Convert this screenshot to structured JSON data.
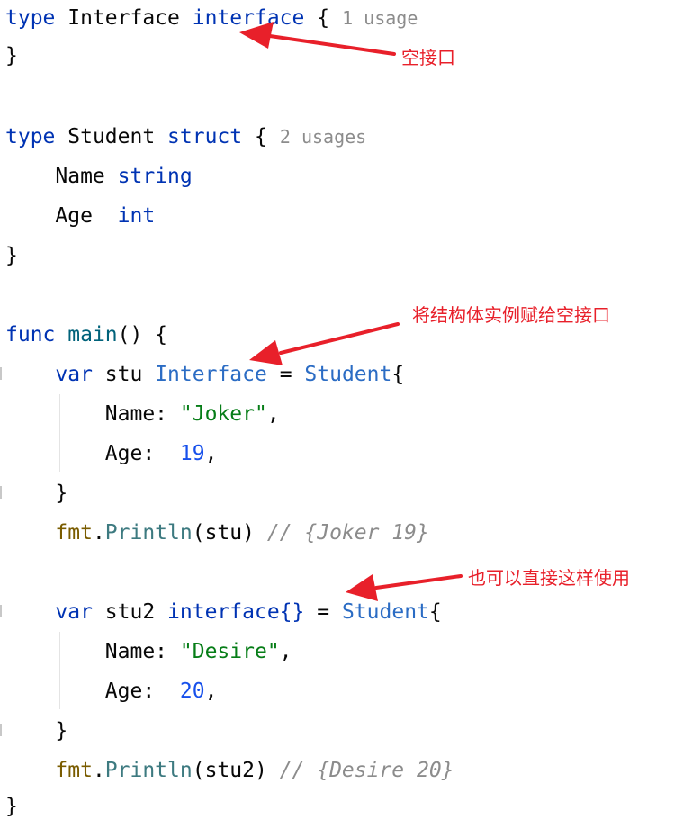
{
  "code": {
    "l1": {
      "kw": "type",
      "name": "Interface",
      "kw2": "interface",
      "brace": "{",
      "hint": "1 usage"
    },
    "l2": {
      "brace": "}"
    },
    "l3": {
      "kw": "type",
      "name": "Student",
      "kw2": "struct",
      "brace": "{",
      "hint": "2 usages"
    },
    "l4": {
      "field": "Name",
      "type": "string"
    },
    "l5": {
      "field": "Age",
      "type": "int"
    },
    "l6": {
      "brace": "}"
    },
    "l7": {
      "kw": "func",
      "name": "main",
      "rest": "() {"
    },
    "l8": {
      "kw": "var",
      "ident": "stu",
      "type": "Interface",
      "eq": "=",
      "ctor": "Student",
      "brace": "{"
    },
    "l9": {
      "field": "Name:",
      "value": "\"Joker\"",
      "comma": ","
    },
    "l10": {
      "field": "Age:",
      "value": "19",
      "comma": ","
    },
    "l11": {
      "brace": "}"
    },
    "l12": {
      "pkg": "fmt",
      "dot": ".",
      "fn": "Println",
      "args": "(stu)",
      "comment": "// {Joker 19}"
    },
    "l13": {
      "kw": "var",
      "ident": "stu2",
      "type": "interface{}",
      "eq": "=",
      "ctor": "Student",
      "brace": "{"
    },
    "l14": {
      "field": "Name:",
      "value": "\"Desire\"",
      "comma": ","
    },
    "l15": {
      "field": "Age:",
      "value": "20",
      "comma": ","
    },
    "l16": {
      "brace": "}"
    },
    "l17": {
      "pkg": "fmt",
      "dot": ".",
      "fn": "Println",
      "args": "(stu2)",
      "comment": "// {Desire 20}"
    },
    "l18": {
      "brace": "}"
    }
  },
  "annotations": {
    "empty_interface": "空接口",
    "assign_struct": "将结构体实例赋给空接口",
    "direct_use": "也可以直接这样使用",
    "color": "#e8202a"
  }
}
